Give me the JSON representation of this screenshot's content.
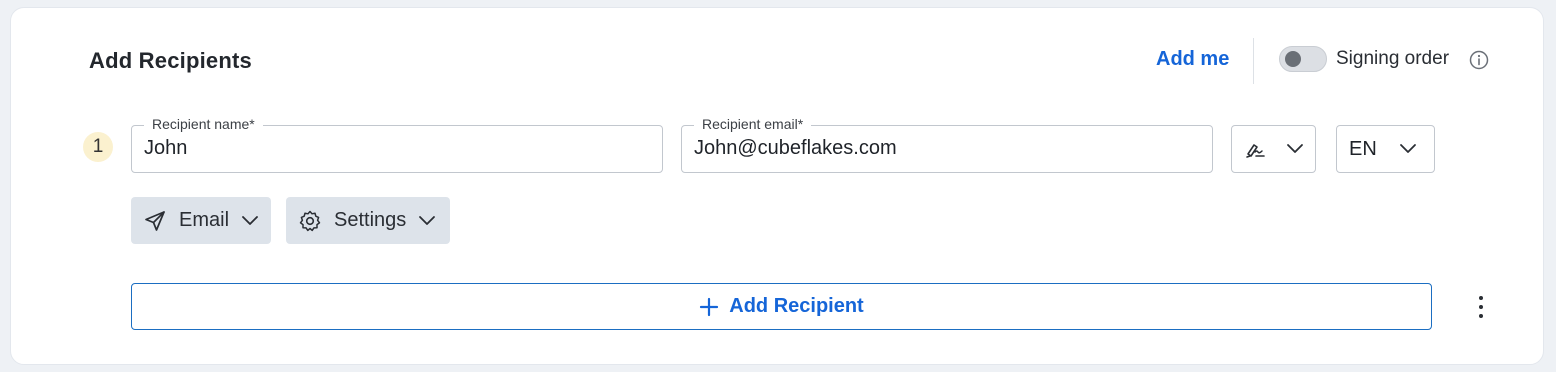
{
  "section": {
    "title": "Add Recipients",
    "add_me_label": "Add me",
    "signing_order_label": "Signing order",
    "signing_order_enabled": false
  },
  "recipients": [
    {
      "index": "1",
      "name_label": "Recipient name*",
      "name_value": "John",
      "email_label": "Recipient email*",
      "email_value": "John@cubeflakes.com",
      "signature_type_icon": "pen-signature-icon",
      "language": "EN",
      "delivery_label": "Email",
      "settings_label": "Settings"
    }
  ],
  "add_recipient_label": "Add Recipient",
  "colors": {
    "accent": "#1565d8",
    "chip_bg": "#dde3ea",
    "badge_bg": "#fbf1cf"
  }
}
